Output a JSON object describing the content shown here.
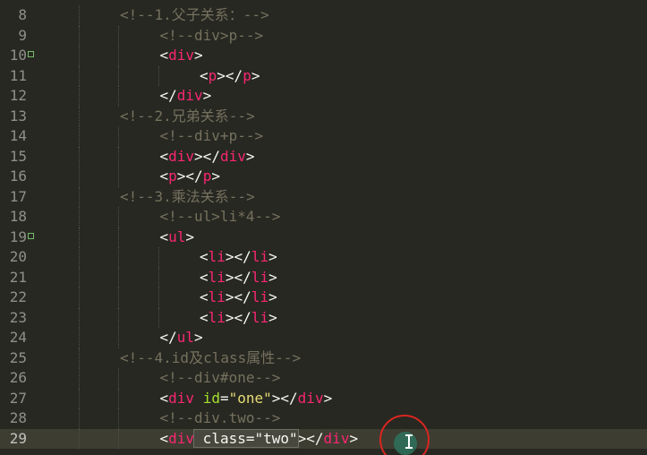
{
  "editor": {
    "lines": [
      {
        "no": "8",
        "fold": false,
        "indent": 2,
        "current": false,
        "tokens": [
          {
            "c": "cm",
            "t": "<!--1.父子关系：-->"
          }
        ]
      },
      {
        "no": "9",
        "fold": false,
        "indent": 3,
        "current": false,
        "tokens": [
          {
            "c": "cm",
            "t": "<!--div>p-->"
          }
        ]
      },
      {
        "no": "10",
        "fold": true,
        "indent": 3,
        "current": false,
        "tokens": [
          {
            "c": "pn",
            "t": "<"
          },
          {
            "c": "tg",
            "t": "div"
          },
          {
            "c": "pn",
            "t": ">"
          }
        ]
      },
      {
        "no": "11",
        "fold": false,
        "indent": 4,
        "current": false,
        "tokens": [
          {
            "c": "pn",
            "t": "<"
          },
          {
            "c": "tg",
            "t": "p"
          },
          {
            "c": "pn",
            "t": "></"
          },
          {
            "c": "tg",
            "t": "p"
          },
          {
            "c": "pn",
            "t": ">"
          }
        ]
      },
      {
        "no": "12",
        "fold": false,
        "indent": 3,
        "current": false,
        "tokens": [
          {
            "c": "pn",
            "t": "</"
          },
          {
            "c": "tg",
            "t": "div"
          },
          {
            "c": "pn",
            "t": ">"
          }
        ]
      },
      {
        "no": "13",
        "fold": false,
        "indent": 2,
        "current": false,
        "tokens": [
          {
            "c": "cm",
            "t": "<!--2.兄弟关系-->"
          }
        ]
      },
      {
        "no": "14",
        "fold": false,
        "indent": 3,
        "current": false,
        "tokens": [
          {
            "c": "cm",
            "t": "<!--div+p-->"
          }
        ]
      },
      {
        "no": "15",
        "fold": false,
        "indent": 3,
        "current": false,
        "tokens": [
          {
            "c": "pn",
            "t": "<"
          },
          {
            "c": "tg",
            "t": "div"
          },
          {
            "c": "pn",
            "t": "></"
          },
          {
            "c": "tg",
            "t": "div"
          },
          {
            "c": "pn",
            "t": ">"
          }
        ]
      },
      {
        "no": "16",
        "fold": false,
        "indent": 3,
        "current": false,
        "tokens": [
          {
            "c": "pn",
            "t": "<"
          },
          {
            "c": "tg",
            "t": "p"
          },
          {
            "c": "pn",
            "t": "></"
          },
          {
            "c": "tg",
            "t": "p"
          },
          {
            "c": "pn",
            "t": ">"
          }
        ]
      },
      {
        "no": "17",
        "fold": false,
        "indent": 2,
        "current": false,
        "tokens": [
          {
            "c": "cm",
            "t": "<!--3.乘法关系-->"
          }
        ]
      },
      {
        "no": "18",
        "fold": false,
        "indent": 3,
        "current": false,
        "tokens": [
          {
            "c": "cm",
            "t": "<!--ul>li*4-->"
          }
        ]
      },
      {
        "no": "19",
        "fold": true,
        "indent": 3,
        "current": false,
        "tokens": [
          {
            "c": "pn",
            "t": "<"
          },
          {
            "c": "tg",
            "t": "ul"
          },
          {
            "c": "pn",
            "t": ">"
          }
        ]
      },
      {
        "no": "20",
        "fold": false,
        "indent": 4,
        "current": false,
        "tokens": [
          {
            "c": "pn",
            "t": "<"
          },
          {
            "c": "tg",
            "t": "li"
          },
          {
            "c": "pn",
            "t": "></"
          },
          {
            "c": "tg",
            "t": "li"
          },
          {
            "c": "pn",
            "t": ">"
          }
        ]
      },
      {
        "no": "21",
        "fold": false,
        "indent": 4,
        "current": false,
        "tokens": [
          {
            "c": "pn",
            "t": "<"
          },
          {
            "c": "tg",
            "t": "li"
          },
          {
            "c": "pn",
            "t": "></"
          },
          {
            "c": "tg",
            "t": "li"
          },
          {
            "c": "pn",
            "t": ">"
          }
        ]
      },
      {
        "no": "22",
        "fold": false,
        "indent": 4,
        "current": false,
        "tokens": [
          {
            "c": "pn",
            "t": "<"
          },
          {
            "c": "tg",
            "t": "li"
          },
          {
            "c": "pn",
            "t": "></"
          },
          {
            "c": "tg",
            "t": "li"
          },
          {
            "c": "pn",
            "t": ">"
          }
        ]
      },
      {
        "no": "23",
        "fold": false,
        "indent": 4,
        "current": false,
        "tokens": [
          {
            "c": "pn",
            "t": "<"
          },
          {
            "c": "tg",
            "t": "li"
          },
          {
            "c": "pn",
            "t": "></"
          },
          {
            "c": "tg",
            "t": "li"
          },
          {
            "c": "pn",
            "t": ">"
          }
        ]
      },
      {
        "no": "24",
        "fold": false,
        "indent": 3,
        "current": false,
        "tokens": [
          {
            "c": "pn",
            "t": "</"
          },
          {
            "c": "tg",
            "t": "ul"
          },
          {
            "c": "pn",
            "t": ">"
          }
        ]
      },
      {
        "no": "25",
        "fold": false,
        "indent": 2,
        "current": false,
        "tokens": [
          {
            "c": "cm",
            "t": "<!--4.id及class属性-->"
          }
        ]
      },
      {
        "no": "26",
        "fold": false,
        "indent": 3,
        "current": false,
        "tokens": [
          {
            "c": "cm",
            "t": "<!--div#one-->"
          }
        ]
      },
      {
        "no": "27",
        "fold": false,
        "indent": 3,
        "current": false,
        "tokens": [
          {
            "c": "pn",
            "t": "<"
          },
          {
            "c": "tg",
            "t": "div"
          },
          {
            "c": "pn",
            "t": " "
          },
          {
            "c": "at",
            "t": "id"
          },
          {
            "c": "pn",
            "t": "="
          },
          {
            "c": "st",
            "t": "\"one\""
          },
          {
            "c": "pn",
            "t": "></"
          },
          {
            "c": "tg",
            "t": "div"
          },
          {
            "c": "pn",
            "t": ">"
          }
        ]
      },
      {
        "no": "28",
        "fold": false,
        "indent": 3,
        "current": false,
        "tokens": [
          {
            "c": "cm",
            "t": "<!--div.two-->"
          }
        ]
      },
      {
        "no": "29",
        "fold": false,
        "indent": 3,
        "current": true,
        "tokens": [
          {
            "c": "pn",
            "t": "<"
          },
          {
            "c": "tg",
            "t": "div"
          },
          {
            "c": "pn sel",
            "t": " class=\"two\""
          },
          {
            "c": "pn",
            "t": "></"
          },
          {
            "c": "tg",
            "t": "div"
          },
          {
            "c": "pn",
            "t": ">"
          }
        ]
      }
    ]
  },
  "colors": {
    "background": "#272822",
    "comment": "#75715e",
    "tag": "#f92672",
    "attribute": "#a6e22e",
    "string": "#e6db74",
    "highlight_circle": "#d8261f"
  }
}
